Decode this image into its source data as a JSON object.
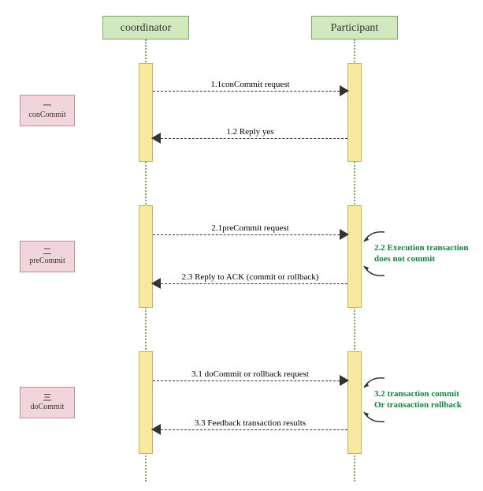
{
  "actors": {
    "coordinator": "coordinator",
    "participant": "Participant"
  },
  "phases": [
    {
      "num": "一",
      "label": "conCommit"
    },
    {
      "num": "二",
      "label": "preCommit"
    },
    {
      "num": "三",
      "label": "doCommit"
    }
  ],
  "messages": {
    "m11": "1.1conCommit request",
    "m12": "1.2 Reply yes",
    "m21": "2.1preCommit request",
    "m23": "2.3 Reply to ACK (commit or rollback)",
    "m31": "3.1 doCommit or rollback request",
    "m33": "3.3 Feedback transaction results"
  },
  "notes": {
    "n22a": "2.2 Execution transaction",
    "n22b": "does not commit",
    "n32a": "3.2 transaction commit",
    "n32b": "Or transaction rollback"
  }
}
